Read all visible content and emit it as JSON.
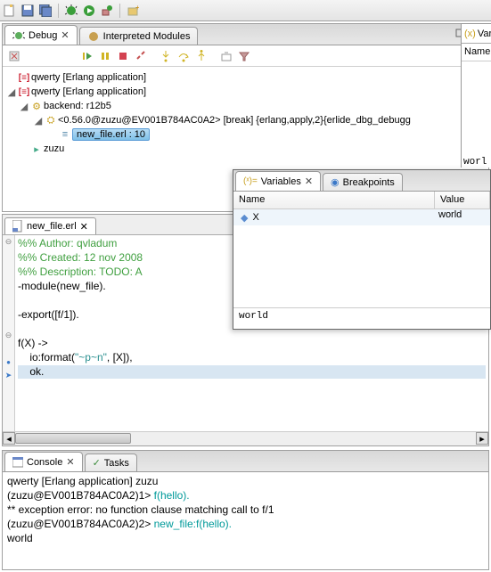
{
  "topTabs": {
    "debug": "Debug",
    "modules": "Interpreted Modules"
  },
  "tree": {
    "n1": "qwerty [Erlang application]",
    "n2": "qwerty [Erlang application]",
    "n3": "backend: r12b5",
    "n4": "<0.56.0@zuzu@EV001B784AC0A2> [break] {erlang,apply,2}{erlide_dbg_debugg",
    "n5": "new_file.erl : 10",
    "n6": "zuzu"
  },
  "editor": {
    "tab": "new_file.erl",
    "line1": "%% Author: qvladum",
    "line2": "%% Created: 12 nov 2008",
    "line3": "%% Description: TODO: A",
    "line4": "-module(new_file).",
    "line5": "",
    "line6": "-export([f/1]).",
    "line7": "",
    "line8": "f(X) ->",
    "line9": "    io:format(",
    "line9_str": "\"~p~n\"",
    "line9_tail": ", [X]),",
    "line10": "    ok."
  },
  "vars": {
    "tabVariables": "Variables",
    "tabBreakpoints": "Breakpoints",
    "colName": "Name",
    "colValue": "Value",
    "rowName": "X",
    "rowValue": "world",
    "detail": "world"
  },
  "rightSlim": {
    "tabFrag": "Var",
    "hdrFrag": "Name",
    "btmFrag": "worl"
  },
  "console": {
    "tabConsole": "Console",
    "tabTasks": "Tasks",
    "title": "qwerty [Erlang application] zuzu",
    "l1_prompt": "(zuzu@EV001B784AC0A2)1> ",
    "l1_cmd": "f(hello).",
    "l2": "** exception error: no function clause matching call to f/1",
    "l3_prompt": "(zuzu@EV001B784AC0A2)2> ",
    "l3_cmd": "new_file:f(hello).",
    "l4": "world"
  }
}
